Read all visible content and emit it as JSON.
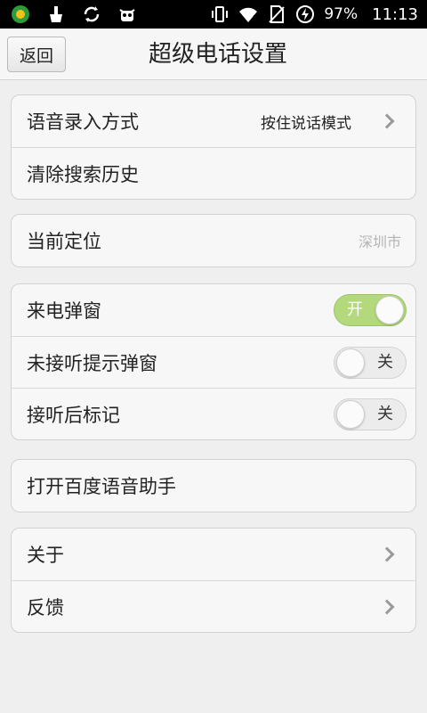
{
  "status_bar": {
    "battery_text": "97%",
    "time": "11:13",
    "icons": [
      "app-logo-icon",
      "cleaner-icon",
      "sync-icon",
      "android-bot-icon",
      "vibrate-icon",
      "wifi-icon",
      "no-sim-icon",
      "battery-saver-icon"
    ]
  },
  "header": {
    "back_label": "返回",
    "title": "超级电话设置"
  },
  "groups": {
    "input": {
      "voice_input_label": "语音录入方式",
      "voice_input_value": "按住说话模式",
      "clear_history_label": "清除搜索历史"
    },
    "location": {
      "label": "当前定位",
      "value": "深圳市"
    },
    "popups": {
      "incoming_label": "来电弹窗",
      "incoming_state": "开",
      "missed_label": "未接听提示弹窗",
      "missed_state": "关",
      "mark_label": "接听后标记",
      "mark_state": "关"
    },
    "assistant": {
      "label": "打开百度语音助手"
    },
    "about": {
      "about_label": "关于",
      "feedback_label": "反馈"
    }
  },
  "colors": {
    "toggle_on": "#b3d97c",
    "background": "#efefef"
  }
}
